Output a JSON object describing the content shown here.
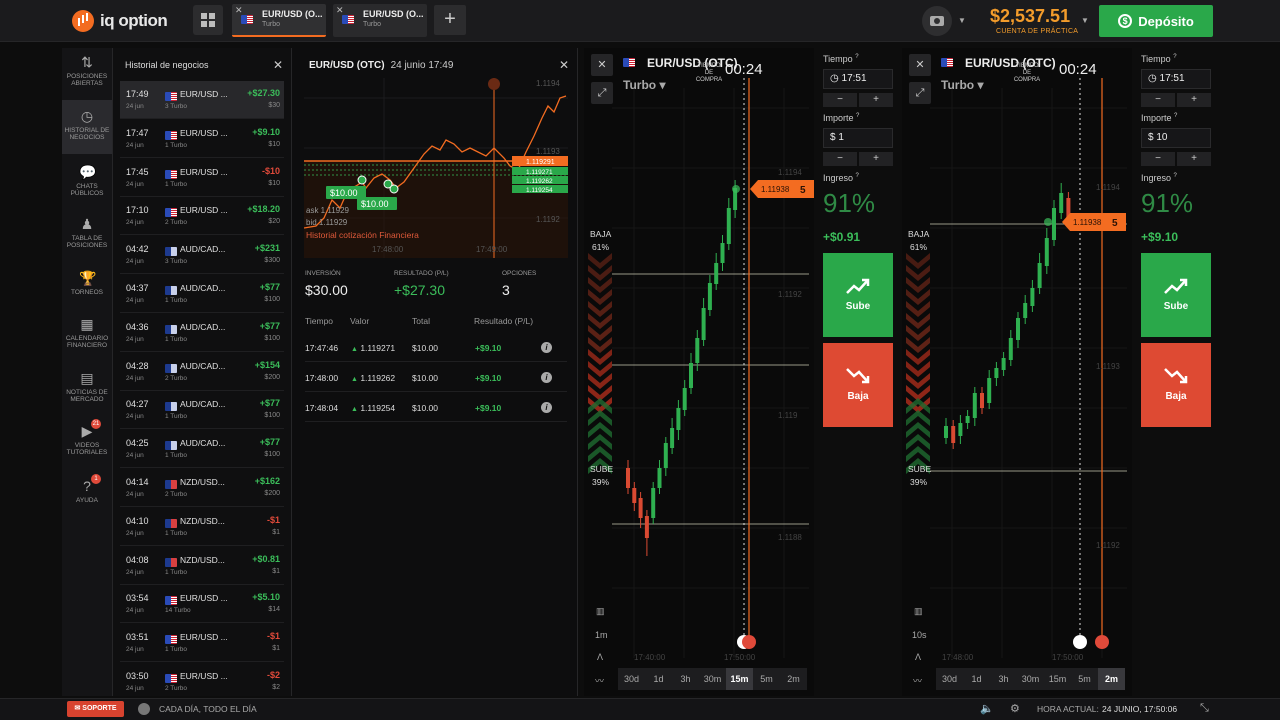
{
  "topbar": {
    "logo_text": "iq option",
    "tabs": [
      {
        "name": "EUR/USD (O...",
        "type": "Turbo",
        "flag_code": "OTC"
      },
      {
        "name": "EUR/USD (O...",
        "type": "Turbo",
        "flag_code": "OTC"
      }
    ],
    "add_tab": "+",
    "balance": "$2,537.51",
    "account_type": "CUENTA DE PRÁCTICA",
    "deposit": "Depósito"
  },
  "leftnav": [
    {
      "label": "POSICIONES ABIERTAS",
      "icon": "sort-arrows-icon"
    },
    {
      "label": "HISTORIAL DE NEGOCIOS",
      "icon": "history-clock-icon",
      "active": true
    },
    {
      "label": "CHATS PÚBLICOS",
      "icon": "chat-icon"
    },
    {
      "label": "TABLA DE POSICIONES",
      "icon": "leaderboard-icon"
    },
    {
      "label": "TORNEOS",
      "icon": "trophy-icon"
    },
    {
      "label": "CALENDARIO FINANCIERO",
      "icon": "calendar-icon"
    },
    {
      "label": "NOTICIAS DE MERCADO",
      "icon": "news-icon"
    },
    {
      "label": "VIDEOS TUTORIALES",
      "icon": "play-icon",
      "badge": "21"
    },
    {
      "label": "AYUDA",
      "icon": "help-icon",
      "badge": "1"
    }
  ],
  "history": {
    "title": "Historial de negocios",
    "trades": [
      {
        "time": "17:49",
        "date": "24 jun",
        "asset": "EUR/USD ...",
        "flag": "eu",
        "type": "3 Turbo",
        "result": "+$27.30",
        "stake": "$30",
        "positive": true
      },
      {
        "time": "17:47",
        "date": "24 jun",
        "asset": "EUR/USD ...",
        "flag": "eu",
        "type": "1 Turbo",
        "result": "+$9.10",
        "stake": "$10",
        "positive": true
      },
      {
        "time": "17:45",
        "date": "24 jun",
        "asset": "EUR/USD ...",
        "flag": "eu",
        "type": "1 Turbo",
        "result": "-$10",
        "stake": "$10",
        "positive": false
      },
      {
        "time": "17:10",
        "date": "24 jun",
        "asset": "EUR/USD ...",
        "flag": "eu",
        "type": "2 Turbo",
        "result": "+$18.20",
        "stake": "$20",
        "positive": true
      },
      {
        "time": "04:42",
        "date": "24 jun",
        "asset": "AUD/CAD...",
        "flag": "au",
        "type": "3 Turbo",
        "result": "+$231",
        "stake": "$300",
        "positive": true
      },
      {
        "time": "04:37",
        "date": "24 jun",
        "asset": "AUD/CAD...",
        "flag": "au",
        "type": "1 Turbo",
        "result": "+$77",
        "stake": "$100",
        "positive": true
      },
      {
        "time": "04:36",
        "date": "24 jun",
        "asset": "AUD/CAD...",
        "flag": "au",
        "type": "1 Turbo",
        "result": "+$77",
        "stake": "$100",
        "positive": true
      },
      {
        "time": "04:28",
        "date": "24 jun",
        "asset": "AUD/CAD...",
        "flag": "au",
        "type": "2 Turbo",
        "result": "+$154",
        "stake": "$200",
        "positive": true
      },
      {
        "time": "04:27",
        "date": "24 jun",
        "asset": "AUD/CAD...",
        "flag": "au",
        "type": "1 Turbo",
        "result": "+$77",
        "stake": "$100",
        "positive": true
      },
      {
        "time": "04:25",
        "date": "24 jun",
        "asset": "AUD/CAD...",
        "flag": "au",
        "type": "1 Turbo",
        "result": "+$77",
        "stake": "$100",
        "positive": true
      },
      {
        "time": "04:14",
        "date": "24 jun",
        "asset": "NZD/USD...",
        "flag": "nz",
        "type": "2 Turbo",
        "result": "+$162",
        "stake": "$200",
        "positive": true
      },
      {
        "time": "04:10",
        "date": "24 jun",
        "asset": "NZD/USD...",
        "flag": "nz",
        "type": "1 Turbo",
        "result": "-$1",
        "stake": "$1",
        "positive": false
      },
      {
        "time": "04:08",
        "date": "24 jun",
        "asset": "NZD/USD...",
        "flag": "nz",
        "type": "1 Turbo",
        "result": "+$0.81",
        "stake": "$1",
        "positive": true
      },
      {
        "time": "03:54",
        "date": "24 jun",
        "asset": "EUR/USD ...",
        "flag": "eu",
        "type": "14 Turbo",
        "result": "+$5.10",
        "stake": "$14",
        "positive": true
      },
      {
        "time": "03:51",
        "date": "24 jun",
        "asset": "EUR/USD ...",
        "flag": "eu",
        "type": "1 Turbo",
        "result": "-$1",
        "stake": "$1",
        "positive": false
      },
      {
        "time": "03:50",
        "date": "24 jun",
        "asset": "EUR/USD ...",
        "flag": "eu",
        "type": "2 Turbo",
        "result": "-$2",
        "stake": "$2",
        "positive": false
      }
    ]
  },
  "details": {
    "asset": "EUR/USD (OTC)",
    "date": "24 junio 17:49",
    "chart": {
      "price_labels": [
        "1.1194",
        "1.1193",
        "1.1192"
      ],
      "level_orange": "1.119291",
      "level_green": [
        "1.119271",
        "1.119262",
        "1.119254"
      ],
      "ask": "ask 1.11929",
      "bid": "bid 1.11929",
      "history_link": "Historial cotización Financiera",
      "time_labels": [
        "17:48:00",
        "17:49:00"
      ],
      "bet_tags": [
        "$10.00",
        "$10.00"
      ]
    },
    "summary": {
      "investment_label": "INVERSIÓN",
      "investment": "$30.00",
      "result_label": "RESULTADO (P/L)",
      "result": "+$27.30",
      "options_label": "OPCIONES",
      "options": "3"
    },
    "columns": [
      "Tiempo",
      "Valor",
      "Total",
      "Resultado (P/L)"
    ],
    "rows": [
      {
        "time": "17:47:46",
        "value": "1.119271",
        "total": "$10.00",
        "result": "+$9.10"
      },
      {
        "time": "17:48:00",
        "value": "1.119262",
        "total": "$10.00",
        "result": "+$9.10"
      },
      {
        "time": "17:48:04",
        "value": "1.119254",
        "total": "$10.00",
        "result": "+$9.10"
      }
    ]
  },
  "pane1": {
    "asset": "EUR/USD (OTC)",
    "type": "Turbo",
    "countdown_label": "TIEMPO DE COMPRA",
    "countdown": "00:24",
    "price_tag": "1.11938",
    "price_tag_digit": "5",
    "price_labels": [
      "1.1194",
      "1.1192",
      "1.119",
      "1.1188"
    ],
    "time_labels": [
      "17:40:00",
      "17:50:00"
    ],
    "baja_label": "BAJA",
    "baja_pct": "61%",
    "sube_label": "SUBE",
    "sube_pct": "39%",
    "interval": "1m",
    "timeframes": [
      "30d",
      "1d",
      "3h",
      "30m",
      "15m",
      "5m",
      "2m"
    ],
    "active_tf": "15m"
  },
  "pane2": {
    "asset": "EUR/USD (OTC)",
    "type": "Turbo",
    "countdown_label": "TIEMPO DE COMPRA",
    "countdown": "00:24",
    "price_tag": "1.11938",
    "price_tag_digit": "5",
    "price_labels": [
      "1.1194",
      "1.1193",
      "1.1192"
    ],
    "time_labels": [
      "17:48:00",
      "17:50:00"
    ],
    "baja_label": "BAJA",
    "baja_pct": "61%",
    "sube_label": "SUBE",
    "sube_pct": "39%",
    "interval": "10s",
    "timeframes": [
      "30d",
      "1d",
      "3h",
      "30m",
      "15m",
      "5m",
      "2m"
    ],
    "active_tf": "2m"
  },
  "order1": {
    "time_label": "Tiempo",
    "time": "17:51",
    "amount_label": "Importe",
    "amount": "$ 1",
    "income_label": "Ingreso",
    "pct": "91%",
    "gain": "+$0.91",
    "up": "Sube",
    "down": "Baja"
  },
  "order2": {
    "time_label": "Tiempo",
    "time": "17:51",
    "amount_label": "Importe",
    "amount": "$ 10",
    "income_label": "Ingreso",
    "pct": "91%",
    "gain": "+$9.10",
    "up": "Sube",
    "down": "Baja"
  },
  "footer": {
    "support": "SOPORTE",
    "hours": "CADA DÍA, TODO EL DÍA",
    "current_time_label": "HORA ACTUAL:",
    "current_time": "24 JUNIO, 17:50:06"
  },
  "colors": {
    "accent": "#f36c21",
    "up": "#2aa84a",
    "down": "#de4a33",
    "balance": "#f39c2b"
  }
}
